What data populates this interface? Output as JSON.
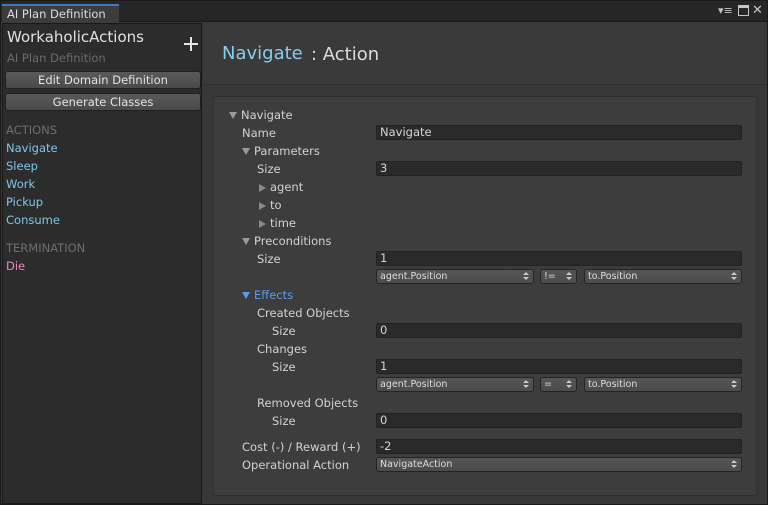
{
  "window": {
    "tab_title": "AI Plan Definition"
  },
  "sidebar": {
    "plan_name": "WorkaholicActions",
    "plan_type": "AI Plan Definition",
    "edit_domain_label": "Edit Domain Definition",
    "generate_classes_label": "Generate Classes",
    "actions_header": "ACTIONS",
    "actions": [
      "Navigate",
      "Sleep",
      "Work",
      "Pickup",
      "Consume"
    ],
    "termination_header": "TERMINATION",
    "terminations": [
      "Die"
    ],
    "colors": {
      "action": "#7cc7ec",
      "termination": "#e888c4"
    }
  },
  "header": {
    "name": "Navigate",
    "type": ": Action"
  },
  "inspector": {
    "root": "Navigate",
    "name_label": "Name",
    "name_value": "Navigate",
    "parameters": {
      "label": "Parameters",
      "size_label": "Size",
      "size_value": "3",
      "items": [
        "agent",
        "to",
        "time"
      ]
    },
    "preconditions": {
      "label": "Preconditions",
      "size_label": "Size",
      "size_value": "1",
      "left": "agent.Position",
      "op": "!=",
      "right": "to.Position"
    },
    "effects": {
      "label": "Effects",
      "created_label": "Created Objects",
      "created_size_label": "Size",
      "created_size_value": "0",
      "changes_label": "Changes",
      "changes_size_label": "Size",
      "changes_size_value": "1",
      "change_left": "agent.Position",
      "change_op": "=",
      "change_right": "to.Position",
      "removed_label": "Removed Objects",
      "removed_size_label": "Size",
      "removed_size_value": "0"
    },
    "reward_label": "Cost (-) / Reward (+)",
    "reward_value": "-2",
    "operational_label": "Operational Action",
    "operational_value": "NavigateAction",
    "accent_color": "#5b9aeb"
  }
}
